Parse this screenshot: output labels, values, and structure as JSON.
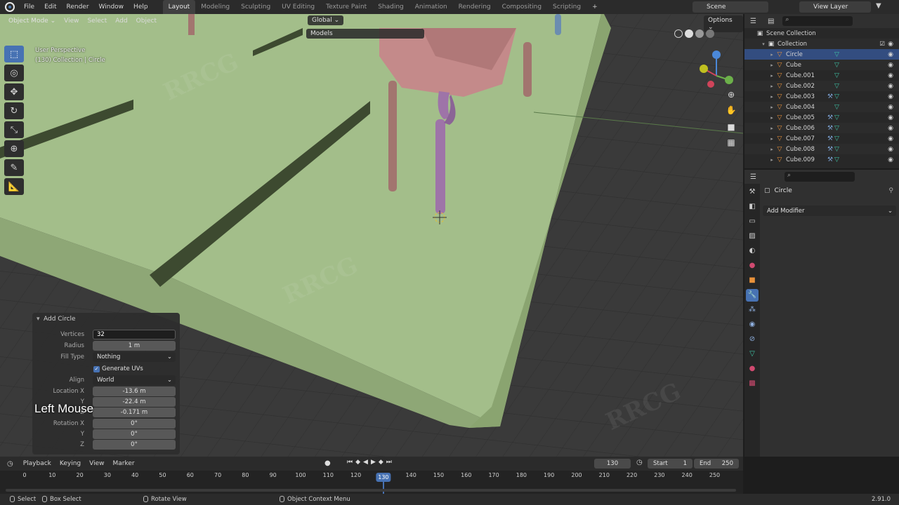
{
  "menubar": {
    "items": [
      "File",
      "Edit",
      "Render",
      "Window",
      "Help"
    ],
    "workspaces": [
      "Layout",
      "Modeling",
      "Sculpting",
      "UV Editing",
      "Texture Paint",
      "Shading",
      "Animation",
      "Rendering",
      "Compositing",
      "Scripting"
    ],
    "active_workspace": "Layout",
    "add_tab": "+",
    "scene": "Scene",
    "view_layer": "View Layer"
  },
  "viewport": {
    "mode": "Object Mode",
    "menus": [
      "View",
      "Select",
      "Add",
      "Object"
    ],
    "orientation": "Global",
    "options": "Options",
    "collection_filter": "Models",
    "view_name": "User Perspective",
    "context": "(130) Collection | Circle"
  },
  "operator_panel": {
    "title": "Add Circle",
    "vertices_label": "Vertices",
    "vertices_value": "32",
    "radius_label": "Radius",
    "radius_value": "1 m",
    "fill_type_label": "Fill Type",
    "fill_type_value": "Nothing",
    "generate_uvs_label": "Generate UVs",
    "generate_uvs_checked": true,
    "align_label": "Align",
    "align_value": "World",
    "location_x_label": "Location X",
    "location_y_label": "Y",
    "location_z_label": "Z",
    "location_x": "-13.6 m",
    "location_y": "-22.4 m",
    "location_z": "-0.171 m",
    "rotation_x_label": "Rotation X",
    "rotation_y_label": "Y",
    "rotation_z_label": "Z",
    "rotation_x": "0°",
    "rotation_y": "0°",
    "rotation_z": "0°"
  },
  "key_overlay": "Left Mouse",
  "outliner": {
    "scene_collection": "Scene Collection",
    "collection": "Collection",
    "items": [
      {
        "name": "Circle",
        "selected": true,
        "modifier": false
      },
      {
        "name": "Cube",
        "selected": false,
        "modifier": false
      },
      {
        "name": "Cube.001",
        "selected": false,
        "modifier": false
      },
      {
        "name": "Cube.002",
        "selected": false,
        "modifier": false
      },
      {
        "name": "Cube.003",
        "selected": false,
        "modifier": true
      },
      {
        "name": "Cube.004",
        "selected": false,
        "modifier": false
      },
      {
        "name": "Cube.005",
        "selected": false,
        "modifier": true
      },
      {
        "name": "Cube.006",
        "selected": false,
        "modifier": true
      },
      {
        "name": "Cube.007",
        "selected": false,
        "modifier": true
      },
      {
        "name": "Cube.008",
        "selected": false,
        "modifier": true
      },
      {
        "name": "Cube.009",
        "selected": false,
        "modifier": true
      }
    ]
  },
  "properties": {
    "object_name": "Circle",
    "add_modifier": "Add Modifier"
  },
  "timeline": {
    "menus": [
      "Playback",
      "Keying",
      "View",
      "Marker"
    ],
    "current_frame": "130",
    "start_label": "Start",
    "start_value": "1",
    "end_label": "End",
    "end_value": "250",
    "ticks": [
      "0",
      "10",
      "20",
      "30",
      "40",
      "50",
      "60",
      "70",
      "80",
      "90",
      "100",
      "110",
      "120",
      "130",
      "140",
      "150",
      "160",
      "170",
      "180",
      "190",
      "200",
      "210",
      "220",
      "230",
      "240",
      "250"
    ]
  },
  "statusbar": {
    "select": "Select",
    "box_select": "Box Select",
    "rotate_view": "Rotate View",
    "context_menu": "Object Context Menu",
    "version": "2.91.0"
  },
  "colors": {
    "accent": "#4772b3",
    "ground_top": "#a3be8a",
    "ground_side": "#8da874",
    "grid": "#3a3a3a",
    "mesh_icon": "#3fc4a6",
    "object_icon": "#e8913a"
  }
}
